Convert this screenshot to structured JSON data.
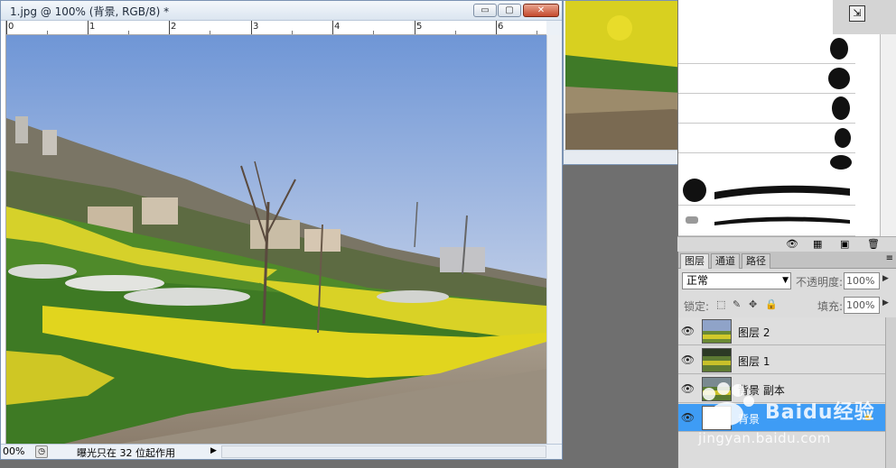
{
  "document": {
    "title": "1.jpg @ 100% (背景, RGB/8) *",
    "buttons": {
      "minimize": "▭",
      "maximize": "▢",
      "close": "✕"
    },
    "ruler_labels": [
      "0",
      "1",
      "2",
      "3",
      "4",
      "5",
      "6"
    ],
    "status": {
      "zoom": "00%",
      "text": "曝光只在 32 位起作用",
      "arrow": "▶"
    }
  },
  "layers_panel": {
    "tabs": [
      "图层",
      "通道",
      "路径"
    ],
    "blend_mode": "正常",
    "opacity_label": "不透明度:",
    "opacity_value": "100%",
    "lock_label": "锁定:",
    "fill_label": "填充:",
    "fill_value": "100%",
    "layers": [
      {
        "name": "图层 2",
        "selected": false
      },
      {
        "name": "图层 1",
        "selected": false
      },
      {
        "name": "背景 副本",
        "selected": false
      },
      {
        "name": "背景",
        "selected": true,
        "locked": true
      }
    ]
  },
  "watermark": {
    "brand": "Baidu经验",
    "url": "jingyan.baidu.com"
  },
  "colors": {
    "selected_layer": "#3e9cf5",
    "sky_top": "#6e97d8",
    "field_yellow": "#e1d51e"
  }
}
